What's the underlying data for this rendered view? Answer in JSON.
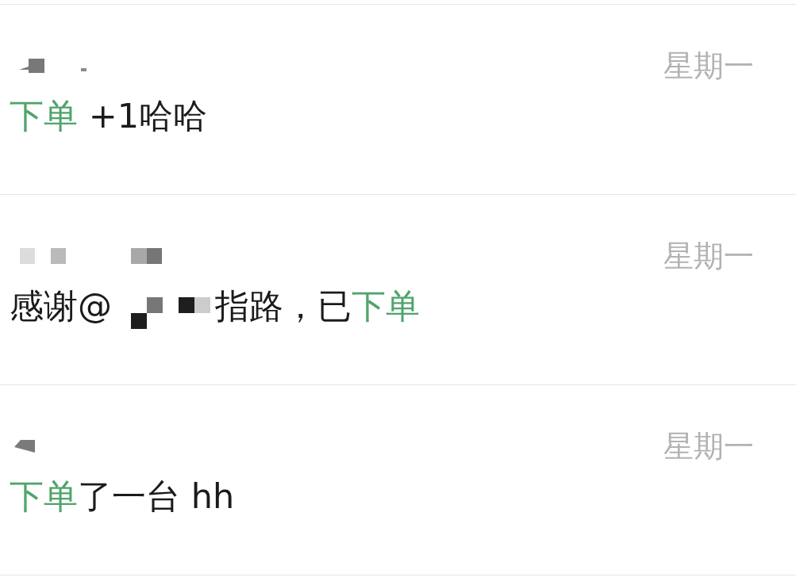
{
  "results": [
    {
      "sender": {
        "kind": "mosaic"
      },
      "time": "星期一",
      "message": [
        {
          "kind": "text",
          "text": "下单",
          "highlight": true
        },
        {
          "kind": "text",
          "text": " +1哈哈",
          "highlight": false
        }
      ]
    },
    {
      "sender": {
        "kind": "mosaic"
      },
      "time": "星期一",
      "message": [
        {
          "kind": "text",
          "text": "感谢@",
          "highlight": false
        },
        {
          "kind": "mosaic"
        },
        {
          "kind": "text",
          "text": "指路，已",
          "highlight": false
        },
        {
          "kind": "text",
          "text": "下单",
          "highlight": true
        }
      ]
    },
    {
      "sender": {
        "kind": "mosaic"
      },
      "time": "星期一",
      "message": [
        {
          "kind": "text",
          "text": "下单",
          "highlight": true
        },
        {
          "kind": "text",
          "text": "了一台 hh",
          "highlight": false
        }
      ]
    }
  ]
}
